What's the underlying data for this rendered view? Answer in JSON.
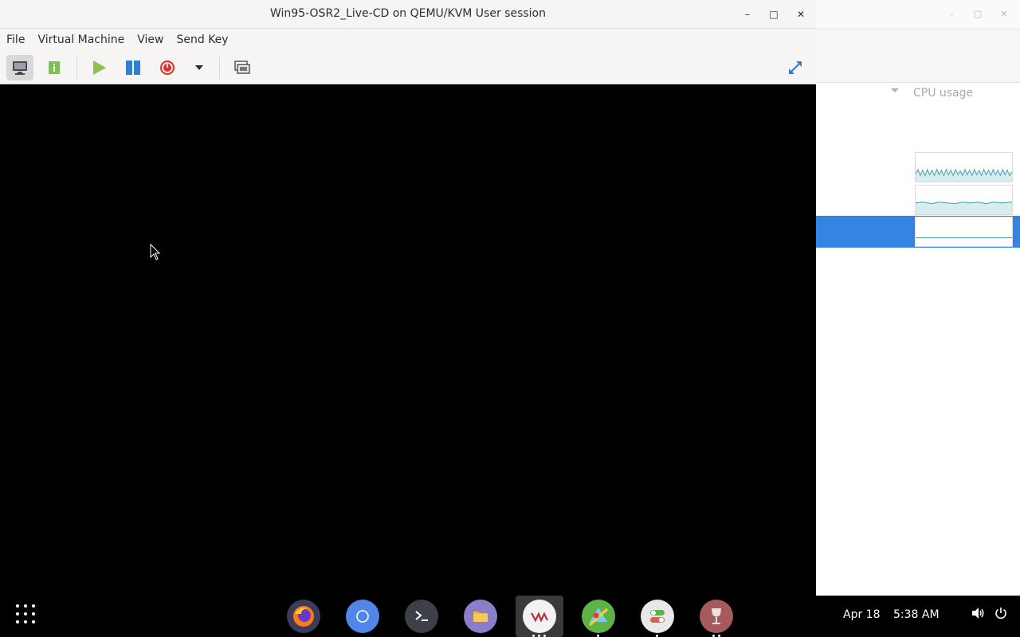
{
  "window": {
    "title": "Win95-OSR2_Live-CD on QEMU/KVM User session",
    "controls": {
      "minimize": "–",
      "maximize": "□",
      "close": "✕"
    }
  },
  "menubar": {
    "items": [
      "File",
      "Virtual Machine",
      "View",
      "Send Key"
    ]
  },
  "toolbar": {
    "icons": [
      "monitor-icon",
      "info-icon",
      "play-icon",
      "pause-icon",
      "power-icon",
      "dropdown-arrow-icon",
      "snapshot-icon",
      "fullscreen-icon"
    ]
  },
  "background_window": {
    "column_header": "CPU usage",
    "selected_row_index": 2,
    "controls": {
      "minimize": "–",
      "maximize": "□",
      "close": "✕"
    }
  },
  "dash": {
    "apps": [
      "firefox-icon",
      "chromium-icon",
      "terminal-icon",
      "files-icon",
      "virt-manager-icon",
      "maps-icon",
      "settings-toggle-icon",
      "wine-glass-icon"
    ],
    "date": "Apr 18",
    "time": "5:38 AM"
  },
  "colors": {
    "selection": "#3584e4",
    "play": "#8bc34a",
    "pause": "#2f80d1",
    "power": "#e0302b"
  }
}
